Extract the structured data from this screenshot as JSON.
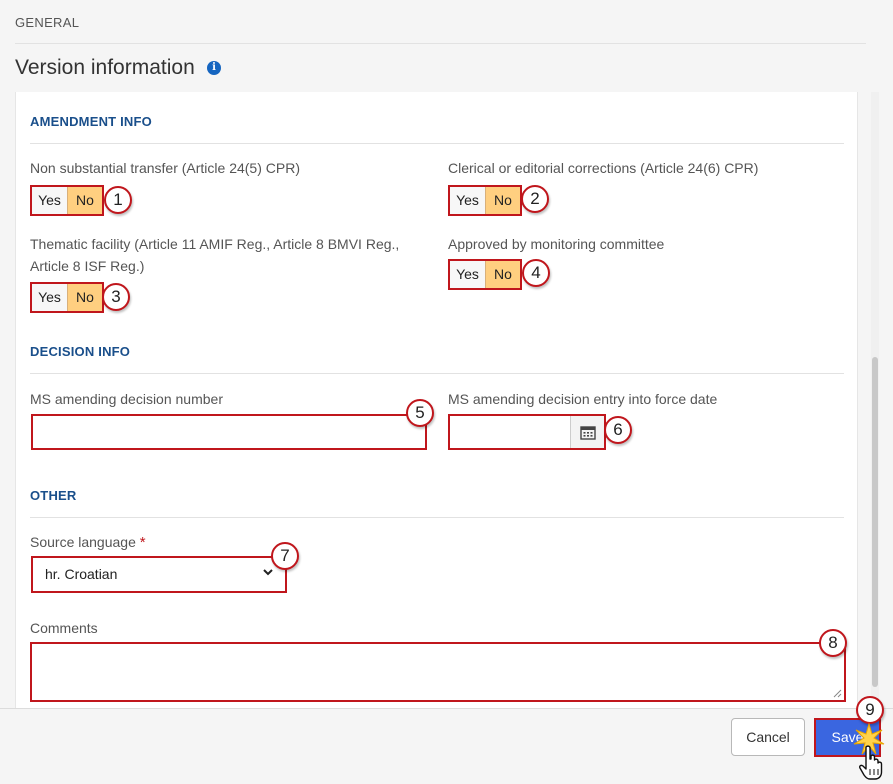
{
  "header": {
    "section_label": "GENERAL",
    "title": "Version information",
    "info_icon": "info-icon"
  },
  "amendment": {
    "title": "AMENDMENT INFO",
    "non_substantial": {
      "label": "Non substantial transfer (Article 24(5) CPR)",
      "yes": "Yes",
      "no": "No",
      "selected": "No",
      "badge": "1"
    },
    "clerical": {
      "label": "Clerical or editorial corrections (Article 24(6) CPR)",
      "yes": "Yes",
      "no": "No",
      "selected": "No",
      "badge": "2"
    },
    "thematic": {
      "label_line1": "Thematic facility (Article 11 AMIF Reg., Article 8 BMVI Reg.,",
      "label_line2": "Article 8 ISF Reg.)",
      "yes": "Yes",
      "no": "No",
      "selected": "No",
      "badge": "3"
    },
    "approved": {
      "label": "Approved by monitoring committee",
      "yes": "Yes",
      "no": "No",
      "selected": "No",
      "badge": "4"
    }
  },
  "decision": {
    "title": "DECISION INFO",
    "number": {
      "label": "MS amending decision number",
      "value": "",
      "badge": "5"
    },
    "date": {
      "label": "MS amending decision entry into force date",
      "value": "",
      "badge": "6",
      "icon": "calendar-icon"
    }
  },
  "other": {
    "title": "OTHER",
    "source_language": {
      "label": "Source language",
      "required_marker": "*",
      "value": "hr. Croatian",
      "badge": "7"
    },
    "comments": {
      "label": "Comments",
      "value": "",
      "badge": "8"
    }
  },
  "footer": {
    "cancel_label": "Cancel",
    "save_label": "Save",
    "save_badge": "9"
  },
  "colors": {
    "highlight": "#c0161c",
    "toggle_selected": "#ffcf80",
    "section_title": "#1a4f8b",
    "save_button": "#3a66e0"
  }
}
